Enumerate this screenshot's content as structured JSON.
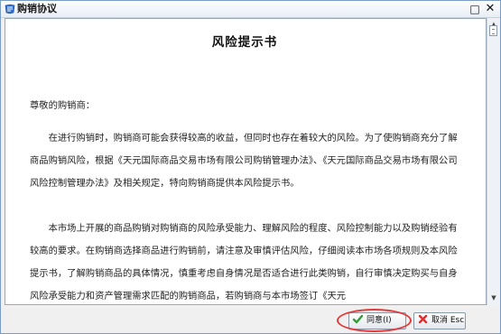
{
  "window": {
    "title": "购销协议",
    "maximize_glyph": "□",
    "close_glyph": "✕"
  },
  "document": {
    "title": "风险提示书",
    "salutation": "尊敬的购销商：",
    "paragraphs": [
      "在进行购销时，购销商可能会获得较高的收益，但同时也存在着较大的风险。为了使购销商充分了解商品购销风险，根据《天元国际商品交易市场有限公司购销管理办法》、《天元国际商品交易市场有限公司风险控制管理办法》及相关规定，特向购销商提供本风险提示书。",
      "本市场上开展的商品购销对购销商的风险承受能力、理解风险的程度、风险控制能力以及购销经验有较高的要求。在购销商选择商品进行购销前，请注意及审慎评估风险，仔细阅读本市场各项规则及本风险提示书，了解购销商品的具体情况，慎重考虑自身情况是否适合进行此类购销，自行审慎决定购买与自身风险承受能力和资产管理需求匹配的购销商品，若购销商与本市场签订《天元"
    ]
  },
  "buttons": {
    "agree_label": "同意(I)",
    "cancel_label": "取消 Esc"
  },
  "icons": {
    "app": "window-app-icon",
    "agree": "green-check-icon",
    "cancel": "red-x-icon"
  },
  "colors": {
    "agree_check": "#2e9e2e",
    "cancel_x": "#d93030",
    "highlight": "#e23b3b"
  }
}
